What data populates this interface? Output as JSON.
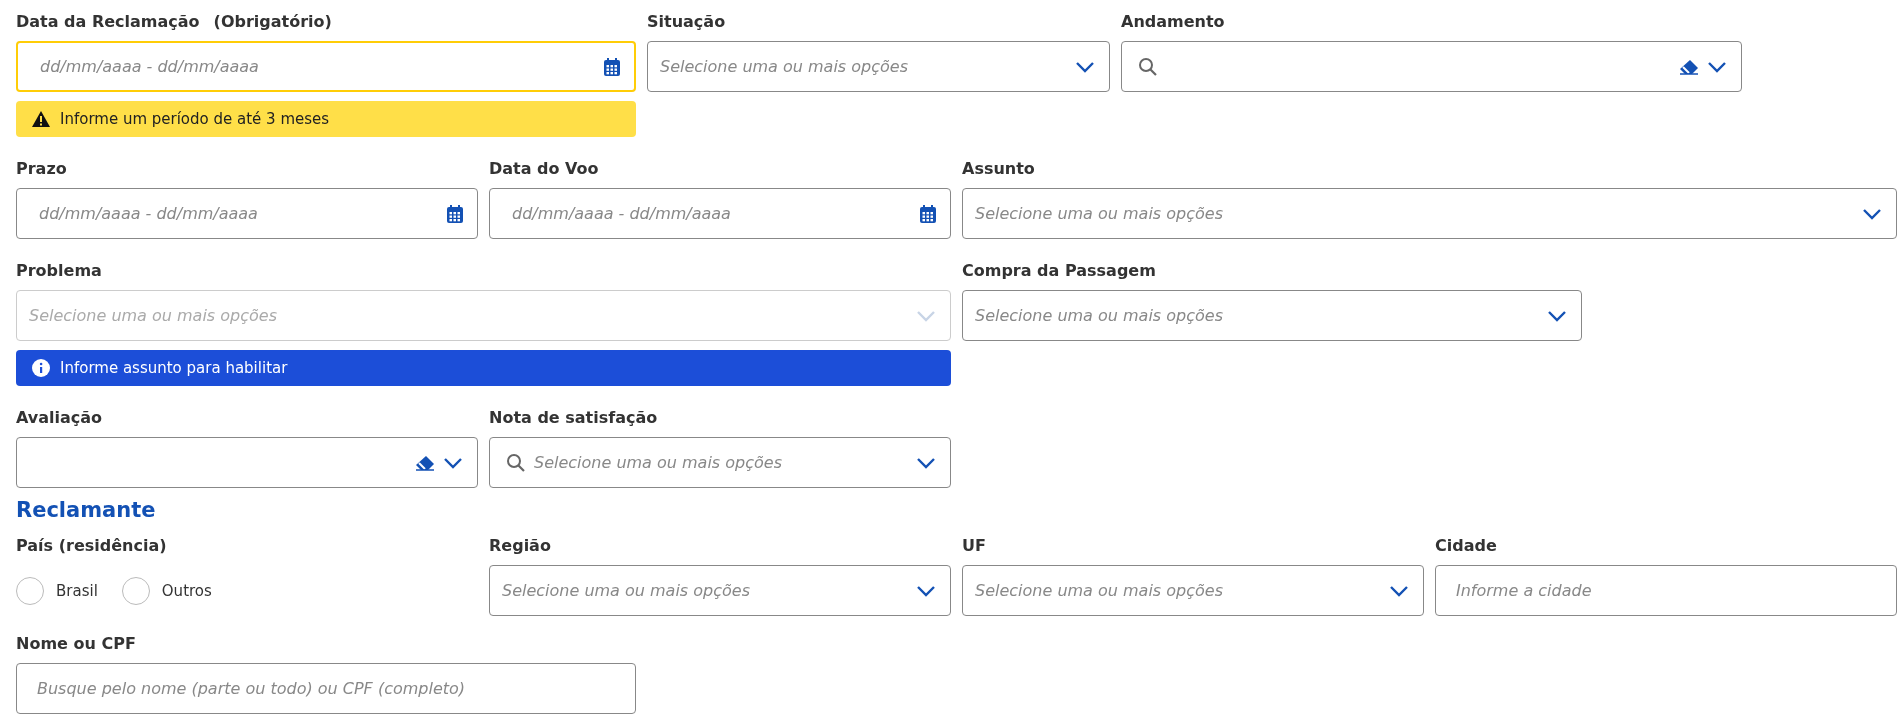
{
  "rows": [
    {
      "fields": [
        {
          "kind": "date",
          "label": "Data da Reclamação",
          "note": "(Obrigatório)",
          "placeholder": "dd/mm/aaaa - dd/mm/aaaa",
          "focused": true,
          "alert": {
            "kind": "warning",
            "text": "Informe um período de até 3 meses"
          }
        },
        {
          "kind": "select",
          "label": "Situação",
          "placeholder": "Selecione uma ou mais opções"
        },
        {
          "kind": "search-select",
          "label": "Andamento",
          "clearable": true
        }
      ]
    },
    {
      "fields": [
        {
          "kind": "date",
          "label": "Prazo",
          "placeholder": "dd/mm/aaaa - dd/mm/aaaa"
        },
        {
          "kind": "date",
          "label": "Data do Voo",
          "placeholder": "dd/mm/aaaa - dd/mm/aaaa"
        },
        {
          "kind": "select",
          "label": "Assunto",
          "placeholder": "Selecione uma ou mais opções"
        }
      ]
    },
    {
      "fields": [
        {
          "kind": "select",
          "label": "Problema",
          "placeholder": "Selecione uma ou mais opções",
          "disabled": true,
          "alert": {
            "kind": "info",
            "text": "Informe assunto para habilitar"
          }
        },
        {
          "kind": "select",
          "label": "Compra da Passagem",
          "placeholder": "Selecione uma ou mais opções"
        }
      ]
    },
    {
      "fields": [
        {
          "kind": "select",
          "label": "Avaliação",
          "clearable": true
        },
        {
          "kind": "search-select",
          "label": "Nota de satisfação",
          "placeholder": "Selecione uma ou mais opções"
        }
      ]
    }
  ],
  "section": {
    "title": "Reclamante",
    "rows": [
      {
        "fields": [
          {
            "kind": "radio",
            "label": "País (residência)",
            "options": [
              {
                "label": "Brasil",
                "selected": false
              },
              {
                "label": "Outros",
                "selected": false
              }
            ]
          },
          {
            "kind": "select",
            "label": "Região",
            "placeholder": "Selecione uma ou mais opções"
          },
          {
            "kind": "select",
            "label": "UF",
            "placeholder": "Selecione uma ou mais opções"
          },
          {
            "kind": "text",
            "label": "Cidade",
            "placeholder": "Informe a cidade"
          }
        ]
      },
      {
        "fields": [
          {
            "kind": "text",
            "label": "Nome ou CPF",
            "placeholder": "Busque pelo nome (parte ou todo) ou CPF (completo)"
          }
        ]
      }
    ]
  }
}
